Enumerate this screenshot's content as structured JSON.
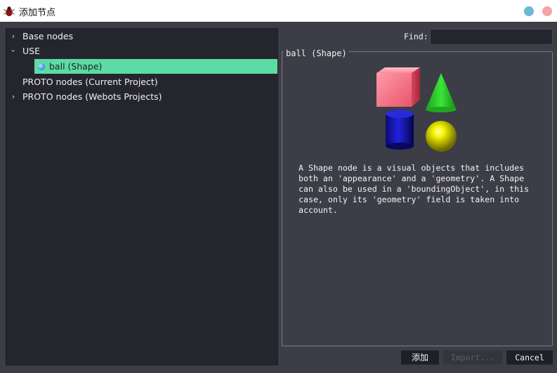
{
  "window": {
    "title": "添加节点",
    "accent_selected": "#5ddba4"
  },
  "tree": {
    "items": [
      {
        "label": "Base nodes",
        "expander": "collapsed"
      },
      {
        "label": "USE",
        "expander": "expanded"
      },
      {
        "label": "ball (Shape)",
        "selected": true,
        "icon": "shape-icon"
      },
      {
        "label": "PROTO nodes (Current Project)",
        "expander": "none"
      },
      {
        "label": "PROTO nodes (Webots Projects)",
        "expander": "collapsed"
      }
    ]
  },
  "find": {
    "label": "Find:",
    "value": ""
  },
  "details": {
    "group_title": "ball (Shape)",
    "description": "A Shape node is a visual objects that includes\nboth an 'appearance' and a 'geometry'. A Shape\ncan also be used in a 'boundingObject', in this\ncase, only its 'geometry' field is taken into\naccount."
  },
  "buttons": {
    "add_label": "添加",
    "import_label": "Import...",
    "cancel_label": "Cancel"
  }
}
